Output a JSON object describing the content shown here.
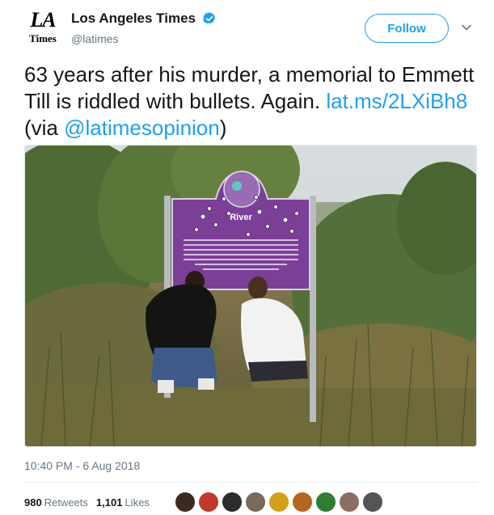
{
  "account": {
    "logo_top": "LA",
    "logo_bottom": "Times",
    "display_name": "Los Angeles Times",
    "handle": "@latimes",
    "verified_icon": "verified-badge-icon"
  },
  "follow_button": {
    "label": "Follow"
  },
  "tweet": {
    "text_main": "63 years after his murder, a memorial to Emmett Till is riddled with bullets. Again.",
    "link": "lat.ms/2LXiBh8",
    "via_open": " (via ",
    "mention": "@latimesopinion",
    "via_close": ")"
  },
  "photo": {
    "sign_heading": "River",
    "sign_text": "This is the site where Till's body was removed from the river. It was then taken to Greenwood, MS. The body was sent back to Money, MS for burial. Via a phone call from Till's mother, ... the body was then taken back to Greenwood. The body was then sent to Tutwiler, MS for preparation to be sent to Chicago, IL"
  },
  "timestamp": "10:40 PM - 6 Aug 2018",
  "stats": {
    "retweets_count": "980",
    "retweets_label": "Retweets",
    "likes_count": "1,101",
    "likes_label": "Likes"
  },
  "avatar_colors": [
    "#3b2a22",
    "#c0392b",
    "#2c2c2c",
    "#7a6a5a",
    "#d4a017",
    "#b5651d",
    "#2e7d32",
    "#8d6e63",
    "#555555"
  ],
  "colors": {
    "accent": "#1da1f2",
    "text": "#14171a",
    "muted": "#657786",
    "sign": "#7b3f98"
  }
}
